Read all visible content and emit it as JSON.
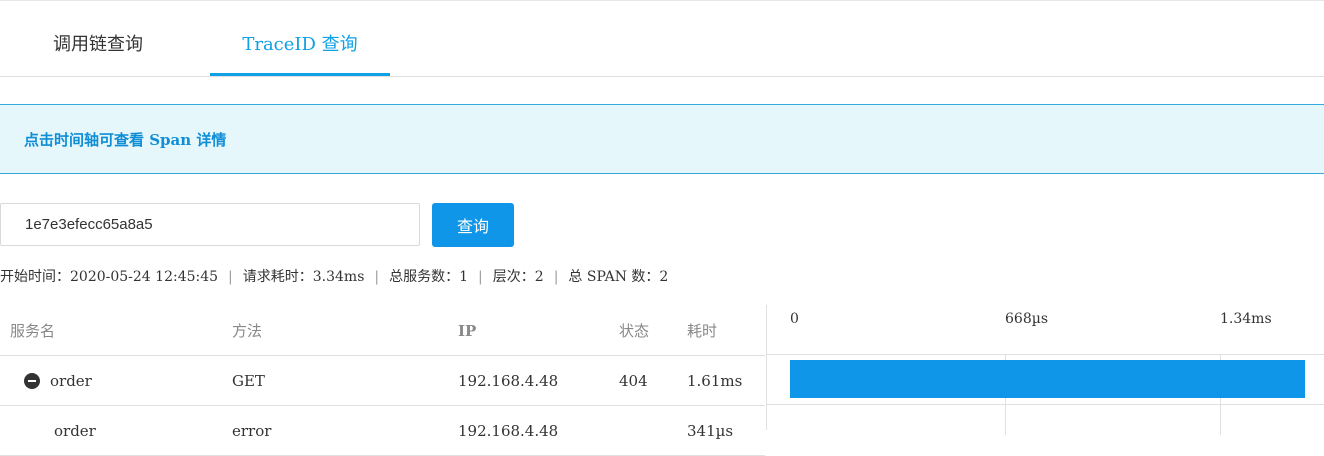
{
  "tabs": [
    {
      "label": "调用链查询",
      "active": false
    },
    {
      "label": "TraceID 查询",
      "active": true
    }
  ],
  "banner": {
    "text": "点击时间轴可查看 Span 详情"
  },
  "search": {
    "value": "1e7e3efecc65a8a5",
    "button_label": "查询"
  },
  "summary": {
    "start_time": "开始时间：2020-05-24 12:45:45",
    "duration": "请求耗时：3.34ms",
    "services": "总服务数：1",
    "levels": "层次：2",
    "spans": "总 SPAN 数：2",
    "separator": "|"
  },
  "table": {
    "headers": [
      "服务名",
      "方法",
      "IP",
      "状态",
      "耗时"
    ],
    "rows": [
      {
        "service": "order",
        "method": "GET",
        "ip": "192.168.4.48",
        "status": "404",
        "duration": "1.61ms"
      },
      {
        "service": "order",
        "method": "error",
        "ip": "192.168.4.48",
        "status": "",
        "duration": "341µs"
      }
    ]
  },
  "timeline": {
    "ticks": [
      "0",
      "668µs",
      "1.34ms"
    ],
    "bar_color": "#0f96e8",
    "spans": [
      {
        "start_fraction": 0.0,
        "end_fraction": 1.0
      }
    ]
  },
  "colors": {
    "accent": "#0fa0e6",
    "banner_bg": "#e6f7fc",
    "banner_border": "#33a9e0"
  }
}
